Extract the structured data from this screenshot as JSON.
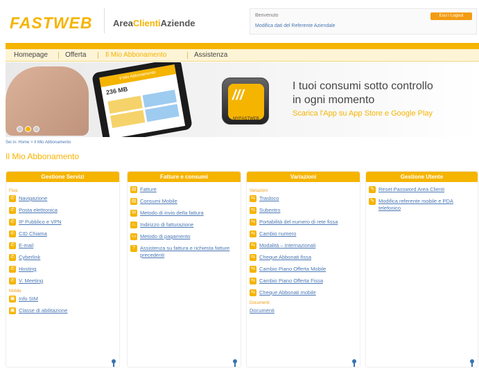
{
  "header": {
    "logo": "FASTWEB",
    "area_part1": "Area",
    "area_part2": "Clienti",
    "area_part3": "Aziende",
    "account_label": "Benvenuto",
    "account_link": "Modifica dati del Referente Aziendale",
    "logout_label": "Esci / Logout"
  },
  "nav": {
    "items": [
      "Homepage",
      "Offerta",
      "Il Mio Abbonamento",
      "Assistenza"
    ]
  },
  "banner": {
    "line1": "I tuoi consumi sotto controllo",
    "line2": "in ogni momento",
    "line3": "Scarica l'App su App Store e Google Play",
    "phone_header": "Il Mio Abbonamento",
    "phone_value": "236 MB",
    "app_label": "MYFASTWEB"
  },
  "breadcrumb": "Sei in: Home > Il Mio Abbonamento",
  "page_title": "Il Mio Abbonamento",
  "columns": [
    {
      "title": "Gestione Servizi",
      "groups": [
        {
          "name": "Fissi",
          "links": [
            "Navigazione",
            "Posta elettronica",
            "IP Pubblico e VPN",
            "CID Chiama",
            "E-mail",
            "Cyberlink",
            "Hosting",
            "V. Meeting"
          ]
        },
        {
          "name": "Mobile",
          "links": [
            "Info SIM",
            "Classe di abilitazione"
          ]
        }
      ]
    },
    {
      "title": "Fatture e consumi",
      "groups": [
        {
          "name": "",
          "links": [
            "Fatture",
            "Consumi Mobile",
            "Metodo di invio della fattura",
            "Indirizzo di fatturazione",
            "Metodo di pagamento",
            "Assistenza su fattura e richiesta fatture precedenti"
          ]
        }
      ]
    },
    {
      "title": "Variazioni",
      "groups": [
        {
          "name": "Variazioni",
          "links": [
            "Trasloco",
            "Subentro",
            "Portabilità del numero di rete fissa",
            "Cambio numero",
            "Modalità – Internazionali",
            "Cheque Abbonati fissa",
            "Cambio Piano Offerta Mobile",
            "Cambio Piano Offerta Fissa",
            "Cheque Abbonati mobile"
          ]
        },
        {
          "name": "Documenti",
          "links": [
            "Documenti"
          ]
        }
      ]
    },
    {
      "title": "Gestione Utente",
      "groups": [
        {
          "name": "",
          "links": [
            "Reset Password Area Clienti",
            "Modifica referente mobile e PDA telefonico"
          ]
        }
      ]
    }
  ]
}
